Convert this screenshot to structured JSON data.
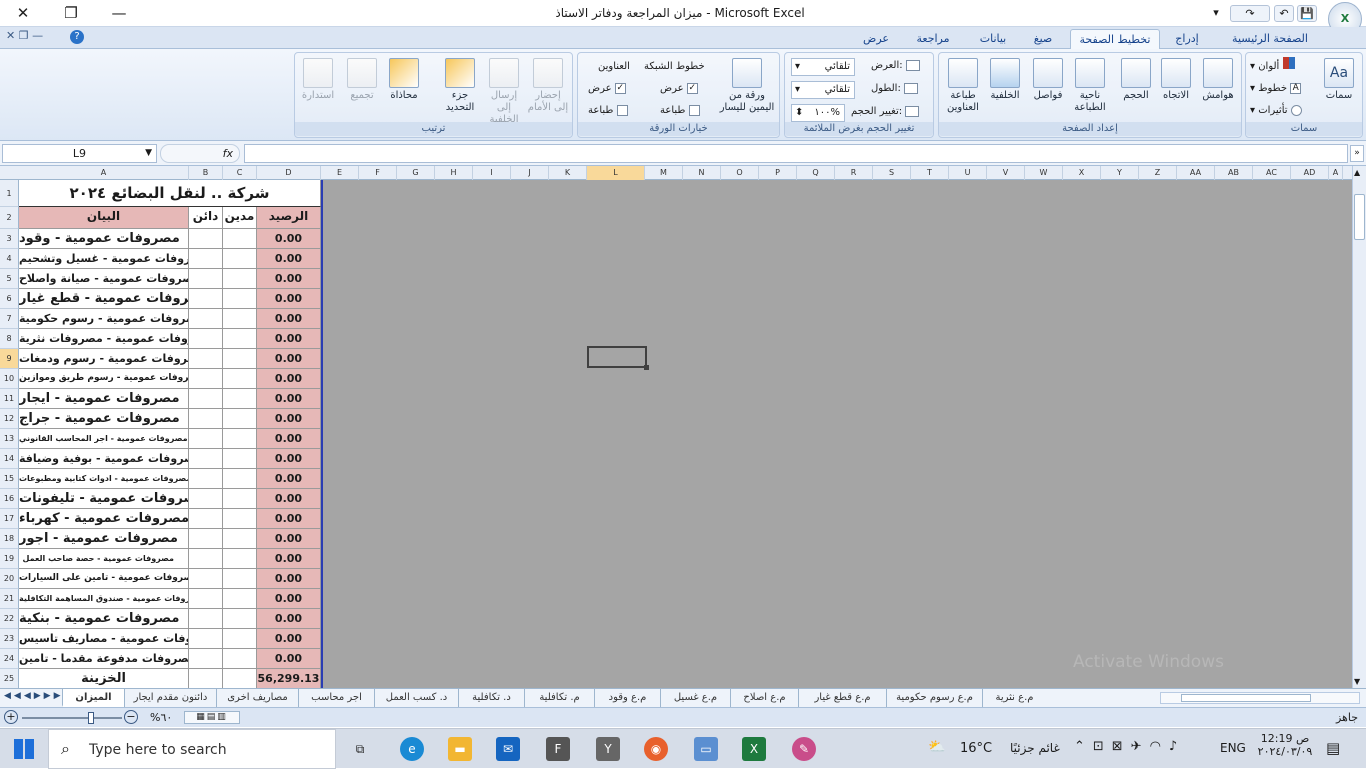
{
  "window": {
    "title": "ميزان المراجعة ودفاتر الاستاذ - Microsoft Excel",
    "close": "✕",
    "restore": "❐",
    "minimize": "—"
  },
  "qat": {
    "save": "💾",
    "undo": "↶",
    "redo": "↷",
    "dropdown": "▾"
  },
  "ribbon_tabs": [
    "عرض",
    "مراجعة",
    "بيانات",
    "صيغ",
    "تخطيط الصفحة",
    "إدراج",
    "الصفحة الرئيسية"
  ],
  "active_tab": "تخطيط الصفحة",
  "groups": {
    "themes": {
      "label": "سمات",
      "themes_btn": "سمات",
      "colors": "ألوان",
      "fonts": "خطوط",
      "effects": "تأثيرات"
    },
    "page_setup": {
      "label": "إعداد الصفحة",
      "margins": "هوامش",
      "orientation": "الاتجاه",
      "size": "الحجم",
      "print_area": "ناحية الطباعة",
      "breaks": "فواصل",
      "background": "الخلفية",
      "print_titles": "طباعة العناوين"
    },
    "scale": {
      "label": "تغيير الحجم بغرض الملائمة",
      "width_label": "العرض:",
      "width_value": "تلقائي",
      "height_label": "الطول:",
      "height_value": "تلقائي",
      "scale_label": "تغيير الحجم:",
      "scale_value": "١٠٠%"
    },
    "sheet_options": {
      "label": "خيارات الورقة",
      "rtl": "ورقة من اليمين لليسار",
      "gridlines": "خطوط الشبكة",
      "headings": "العناوين",
      "view": "عرض",
      "print": "طباعة"
    },
    "arrange": {
      "label": "ترتيب",
      "bring_forward": "إحضار إلى الأمام",
      "send_backward": "إرسال إلى الخلفية",
      "selection_pane": "جزء التحديد",
      "align": "محاذاة",
      "group": "تجميع",
      "rotate": "استدارة"
    }
  },
  "formula_bar": {
    "name_box": "L9",
    "fx": "fx",
    "formula": ""
  },
  "columns": [
    "A",
    "B",
    "C",
    "D",
    "E",
    "F",
    "G",
    "H",
    "I",
    "J",
    "K",
    "L",
    "M",
    "N",
    "O",
    "P",
    "Q",
    "R",
    "S",
    "T",
    "U",
    "V",
    "W",
    "X",
    "Y",
    "Z",
    "AA",
    "AB",
    "AC",
    "AD",
    "A"
  ],
  "sheet": {
    "title": "شركة .. لنقل البضائع ٢٠٢٤",
    "headers": {
      "desc": "البيان",
      "credit": "دائن",
      "debit": "مدين",
      "balance": "الرصيد"
    },
    "rows": [
      {
        "n": "3",
        "desc": "مصروفات عمومية - وقود",
        "bal": "0.00",
        "fs": "13px"
      },
      {
        "n": "4",
        "desc": "مصروفات عمومية - غسيل وتشحيم",
        "bal": "0.00",
        "fs": "11px"
      },
      {
        "n": "5",
        "desc": "مصروفات عمومية - صيانة واصلاح",
        "bal": "0.00",
        "fs": "11px"
      },
      {
        "n": "6",
        "desc": "مصروفات عمومية - قطع غيار",
        "bal": "0.00",
        "fs": "13px"
      },
      {
        "n": "7",
        "desc": "مصروفات عمومية - رسوم حكومية",
        "bal": "0.00",
        "fs": "11px"
      },
      {
        "n": "8",
        "desc": "مصروفات عمومية - مصروفات نثرية",
        "bal": "0.00",
        "fs": "11px"
      },
      {
        "n": "9",
        "desc": "مصروفات عمومية - رسوم ودمغات",
        "bal": "0.00",
        "fs": "11px"
      },
      {
        "n": "10",
        "desc": "مصروفات عمومية - رسوم طريق وموازين",
        "bal": "0.00",
        "fs": "9px"
      },
      {
        "n": "11",
        "desc": "مصروفات عمومية - ايجار",
        "bal": "0.00",
        "fs": "13px"
      },
      {
        "n": "12",
        "desc": "مصروفات عمومية - جراج",
        "bal": "0.00",
        "fs": "13px"
      },
      {
        "n": "13",
        "desc": "مصروفات عمومية - اجر المحاسب القانوني",
        "bal": "0.00",
        "fs": "8px"
      },
      {
        "n": "14",
        "desc": "مصروفات عمومية - بوفية وضيافة",
        "bal": "0.00",
        "fs": "11px"
      },
      {
        "n": "15",
        "desc": "مصروفات عمومية - ادوات كتابية ومطبوعات",
        "bal": "0.00",
        "fs": "8px"
      },
      {
        "n": "16",
        "desc": "مصروفات عمومية - تليفونات",
        "bal": "0.00",
        "fs": "13px"
      },
      {
        "n": "17",
        "desc": "مصروفات عمومية - كهرباء",
        "bal": "0.00",
        "fs": "13px"
      },
      {
        "n": "18",
        "desc": "مصروفات عمومية - اجور",
        "bal": "0.00",
        "fs": "13px"
      },
      {
        "n": "19",
        "desc": "مصروفات عمومية - حصة صاحب العمل",
        "bal": "0.00",
        "fs": "8px"
      },
      {
        "n": "20",
        "desc": "مصروفات عمومية - تامين على السيارات",
        "bal": "0.00",
        "fs": "9px"
      },
      {
        "n": "21",
        "desc": "مصروفات عمومية - صندوق المساهمة التكافلية",
        "bal": "0.00",
        "fs": "8px"
      },
      {
        "n": "22",
        "desc": "مصروفات عمومية - بنكية",
        "bal": "0.00",
        "fs": "13px"
      },
      {
        "n": "23",
        "desc": "مصروفات عمومية - مصاريف تاسيس",
        "bal": "0.00",
        "fs": "11px"
      },
      {
        "n": "24",
        "desc": "مصروفات مدفوعة مقدما - تامين",
        "bal": "0.00",
        "fs": "11px"
      },
      {
        "n": "25",
        "desc": "الخزينة",
        "bal": "56,299.13",
        "fs": "13px"
      }
    ]
  },
  "sheet_tabs": [
    "الميزان",
    "دائنون مقدم ايجار",
    "مصاريف اخرى",
    "اجر محاسب",
    "د. كسب العمل",
    "د. تكافلية",
    "م. تكافلية",
    "م.ع وقود",
    "م.ع غسيل",
    "م.ع اصلاح",
    "م.ع قطع غيار",
    "م.ع رسوم حكومية",
    "م.ع نثرية"
  ],
  "status": {
    "ready": "جاهز",
    "zoom": "%٦٠"
  },
  "watermark": "Activate Windows",
  "taskbar": {
    "search_placeholder": "Type here to search",
    "temp": "16°C",
    "weather": "غائم جزئيًا",
    "lang": "ENG",
    "time": "ص 12:19",
    "date": "٢٠٢٤/٠٣/٠٩"
  }
}
